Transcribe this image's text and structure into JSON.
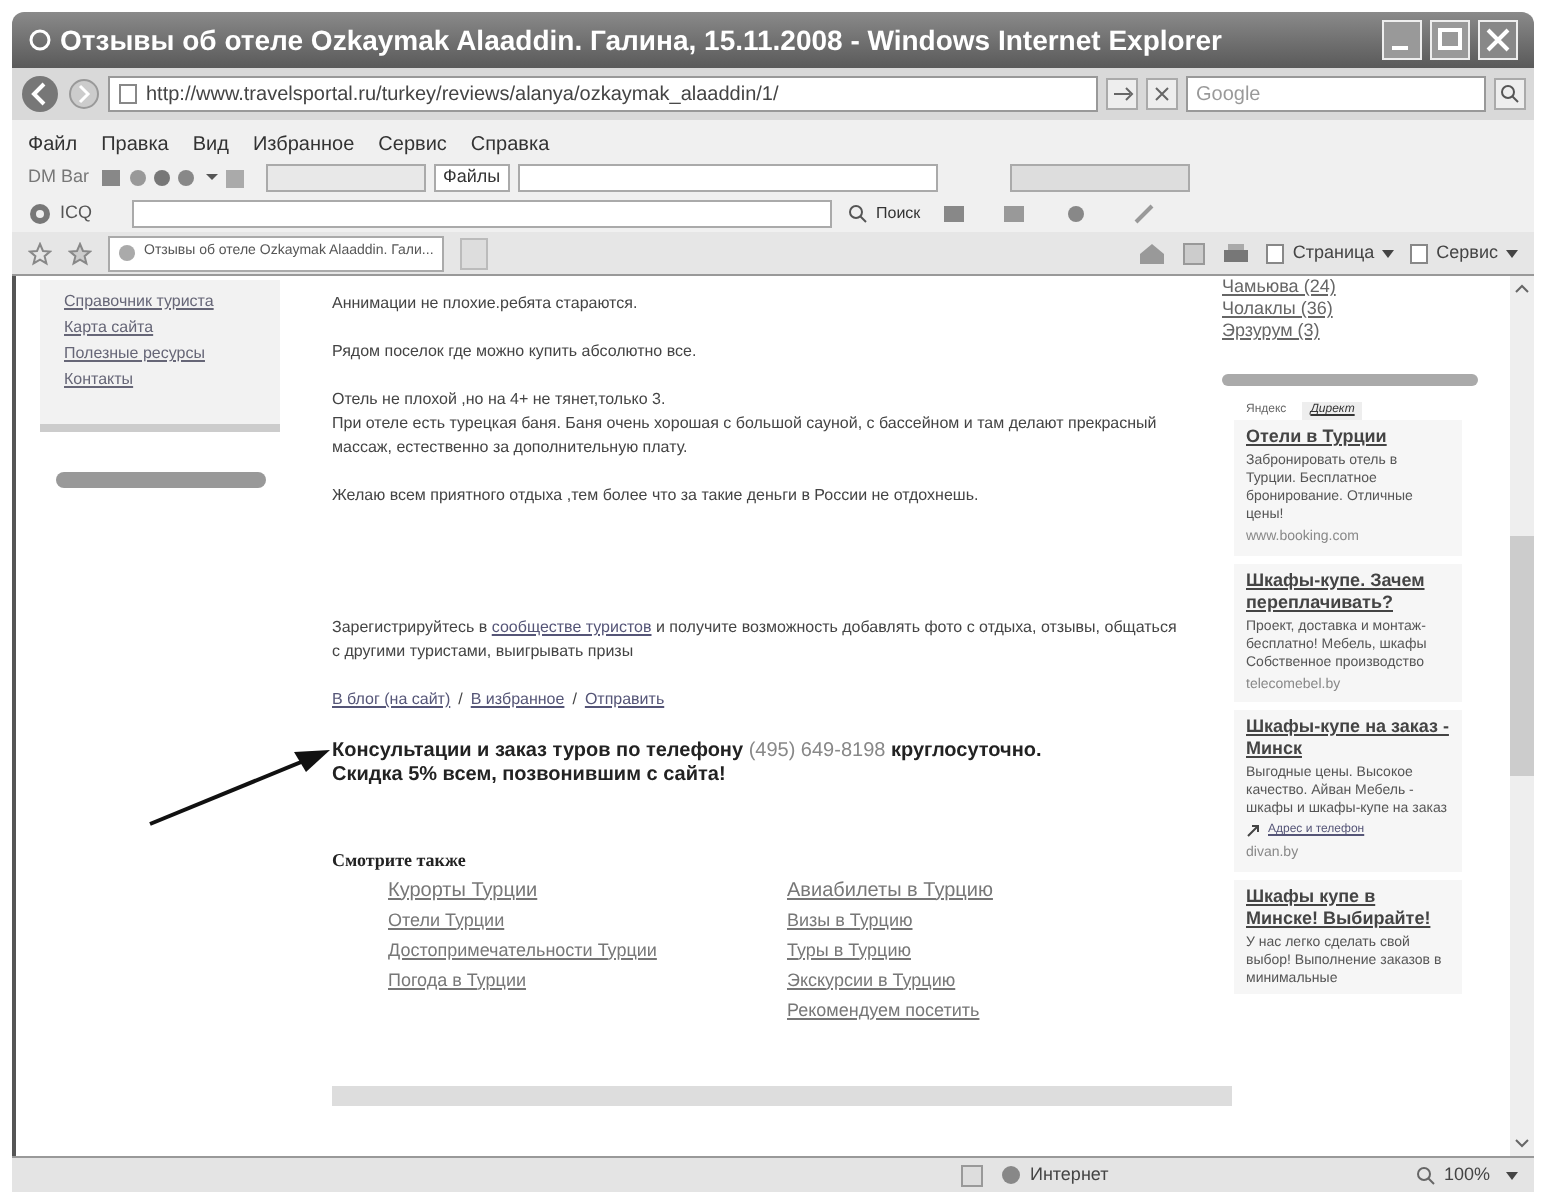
{
  "window": {
    "title": "Отзывы об отеле Ozkaymak Alaaddin. Галина, 15.11.2008 - Windows Internet Explorer"
  },
  "address_bar": {
    "url": "http://www.travelsportal.ru/turkey/reviews/alanya/ozkaymak_alaaddin/1/",
    "search_placeholder": "Google"
  },
  "menu": [
    "Файл",
    "Правка",
    "Вид",
    "Избранное",
    "Сервис",
    "Справка"
  ],
  "toolbar_1": {
    "label": "DM Bar",
    "dropdown": "Файлы"
  },
  "toolbar_2": {
    "label": "ICQ",
    "search_button": "Поиск"
  },
  "tab": {
    "title": "Отзывы об отеле Ozkaymak Alaaddin. Гали..."
  },
  "command_bar": [
    "Страница",
    "Сервис"
  ],
  "sidebar": {
    "links": [
      "Справочник туриста",
      "Карта сайта",
      "Полезные ресурсы",
      "Контакты"
    ]
  },
  "review": [
    [
      "Аннимации не плохие.ребята стараются."
    ],
    [
      "Рядом поселок где можно купить абсолютно все."
    ],
    [
      "Отель не плохой ,но на 4+ не тянет,только 3.",
      "При отеле есть турецкая баня. Баня очень хорошая с большой сауной, с бассейном и там делают прекрасный массаж, естественно за дополнительную плату."
    ],
    [
      "Желаю всем приятного отдыха ,тем более что за такие деньги в России не отдохнешь."
    ]
  ],
  "register": {
    "before": "Зарегистрируйтесь в ",
    "link": "сообществе туристов",
    "after": " и получите возможность добавлять фото с отдыха, отзывы, общаться с другими туристами, выигрывать призы"
  },
  "actions": {
    "links": [
      "В блог (на сайт)",
      "В избранное",
      "Отправить"
    ],
    "separator": "/"
  },
  "phone_notice": {
    "before": "Консультации и заказ туров по телефону ",
    "phone": "(495) 649-8198",
    "after": " круглосуточно.",
    "line_2": "Скидка 5% всем, позвонившим с сайта!"
  },
  "see_also": {
    "title": "Смотрите также",
    "columns": [
      [
        "Курорты Турции",
        "Отели Турции",
        "Достопримечательности Турции",
        "Погода в Турции"
      ],
      [
        "Авиабилеты в Турцию",
        "Визы в Турцию",
        "Туры в Турцию",
        "Экскурсии в Турцию",
        "Рекомендуем посетить"
      ]
    ]
  },
  "regions": [
    "Чамьюва (24)",
    "Чолаклы (36)",
    "Эрзурум (3)"
  ],
  "ads_tabs": [
    {
      "label": "Яндекс",
      "selected": false
    },
    {
      "label": "Директ",
      "selected": true
    }
  ],
  "ads": [
    {
      "title": "Отели в Турции",
      "text": "Забронировать отель в Турции. Бесплатное бронирование. Отличные цены!",
      "domain": "www.booking.com"
    },
    {
      "title": "Шкафы-купе. Зачем переплачивать?",
      "text": "Проект, доставка и монтаж-бесплатно! Мебель, шкафы Собственное производство",
      "domain": "telecomebel.by"
    },
    {
      "title": "Шкафы-купе на заказ - Минск",
      "text": "Выгодные цены. Высокое качество. Айван Мебель - шкафы и шкафы-купе на заказ",
      "contact": "Адрес и телефон",
      "domain": "divan.by"
    },
    {
      "title": "Шкафы купе в Минске! Выбирайте!",
      "text": "У нас легко сделать свой выбор! Выполнение заказов в минимальные"
    }
  ],
  "status_bar": {
    "zone": "Интернет",
    "zoom": "100%"
  }
}
